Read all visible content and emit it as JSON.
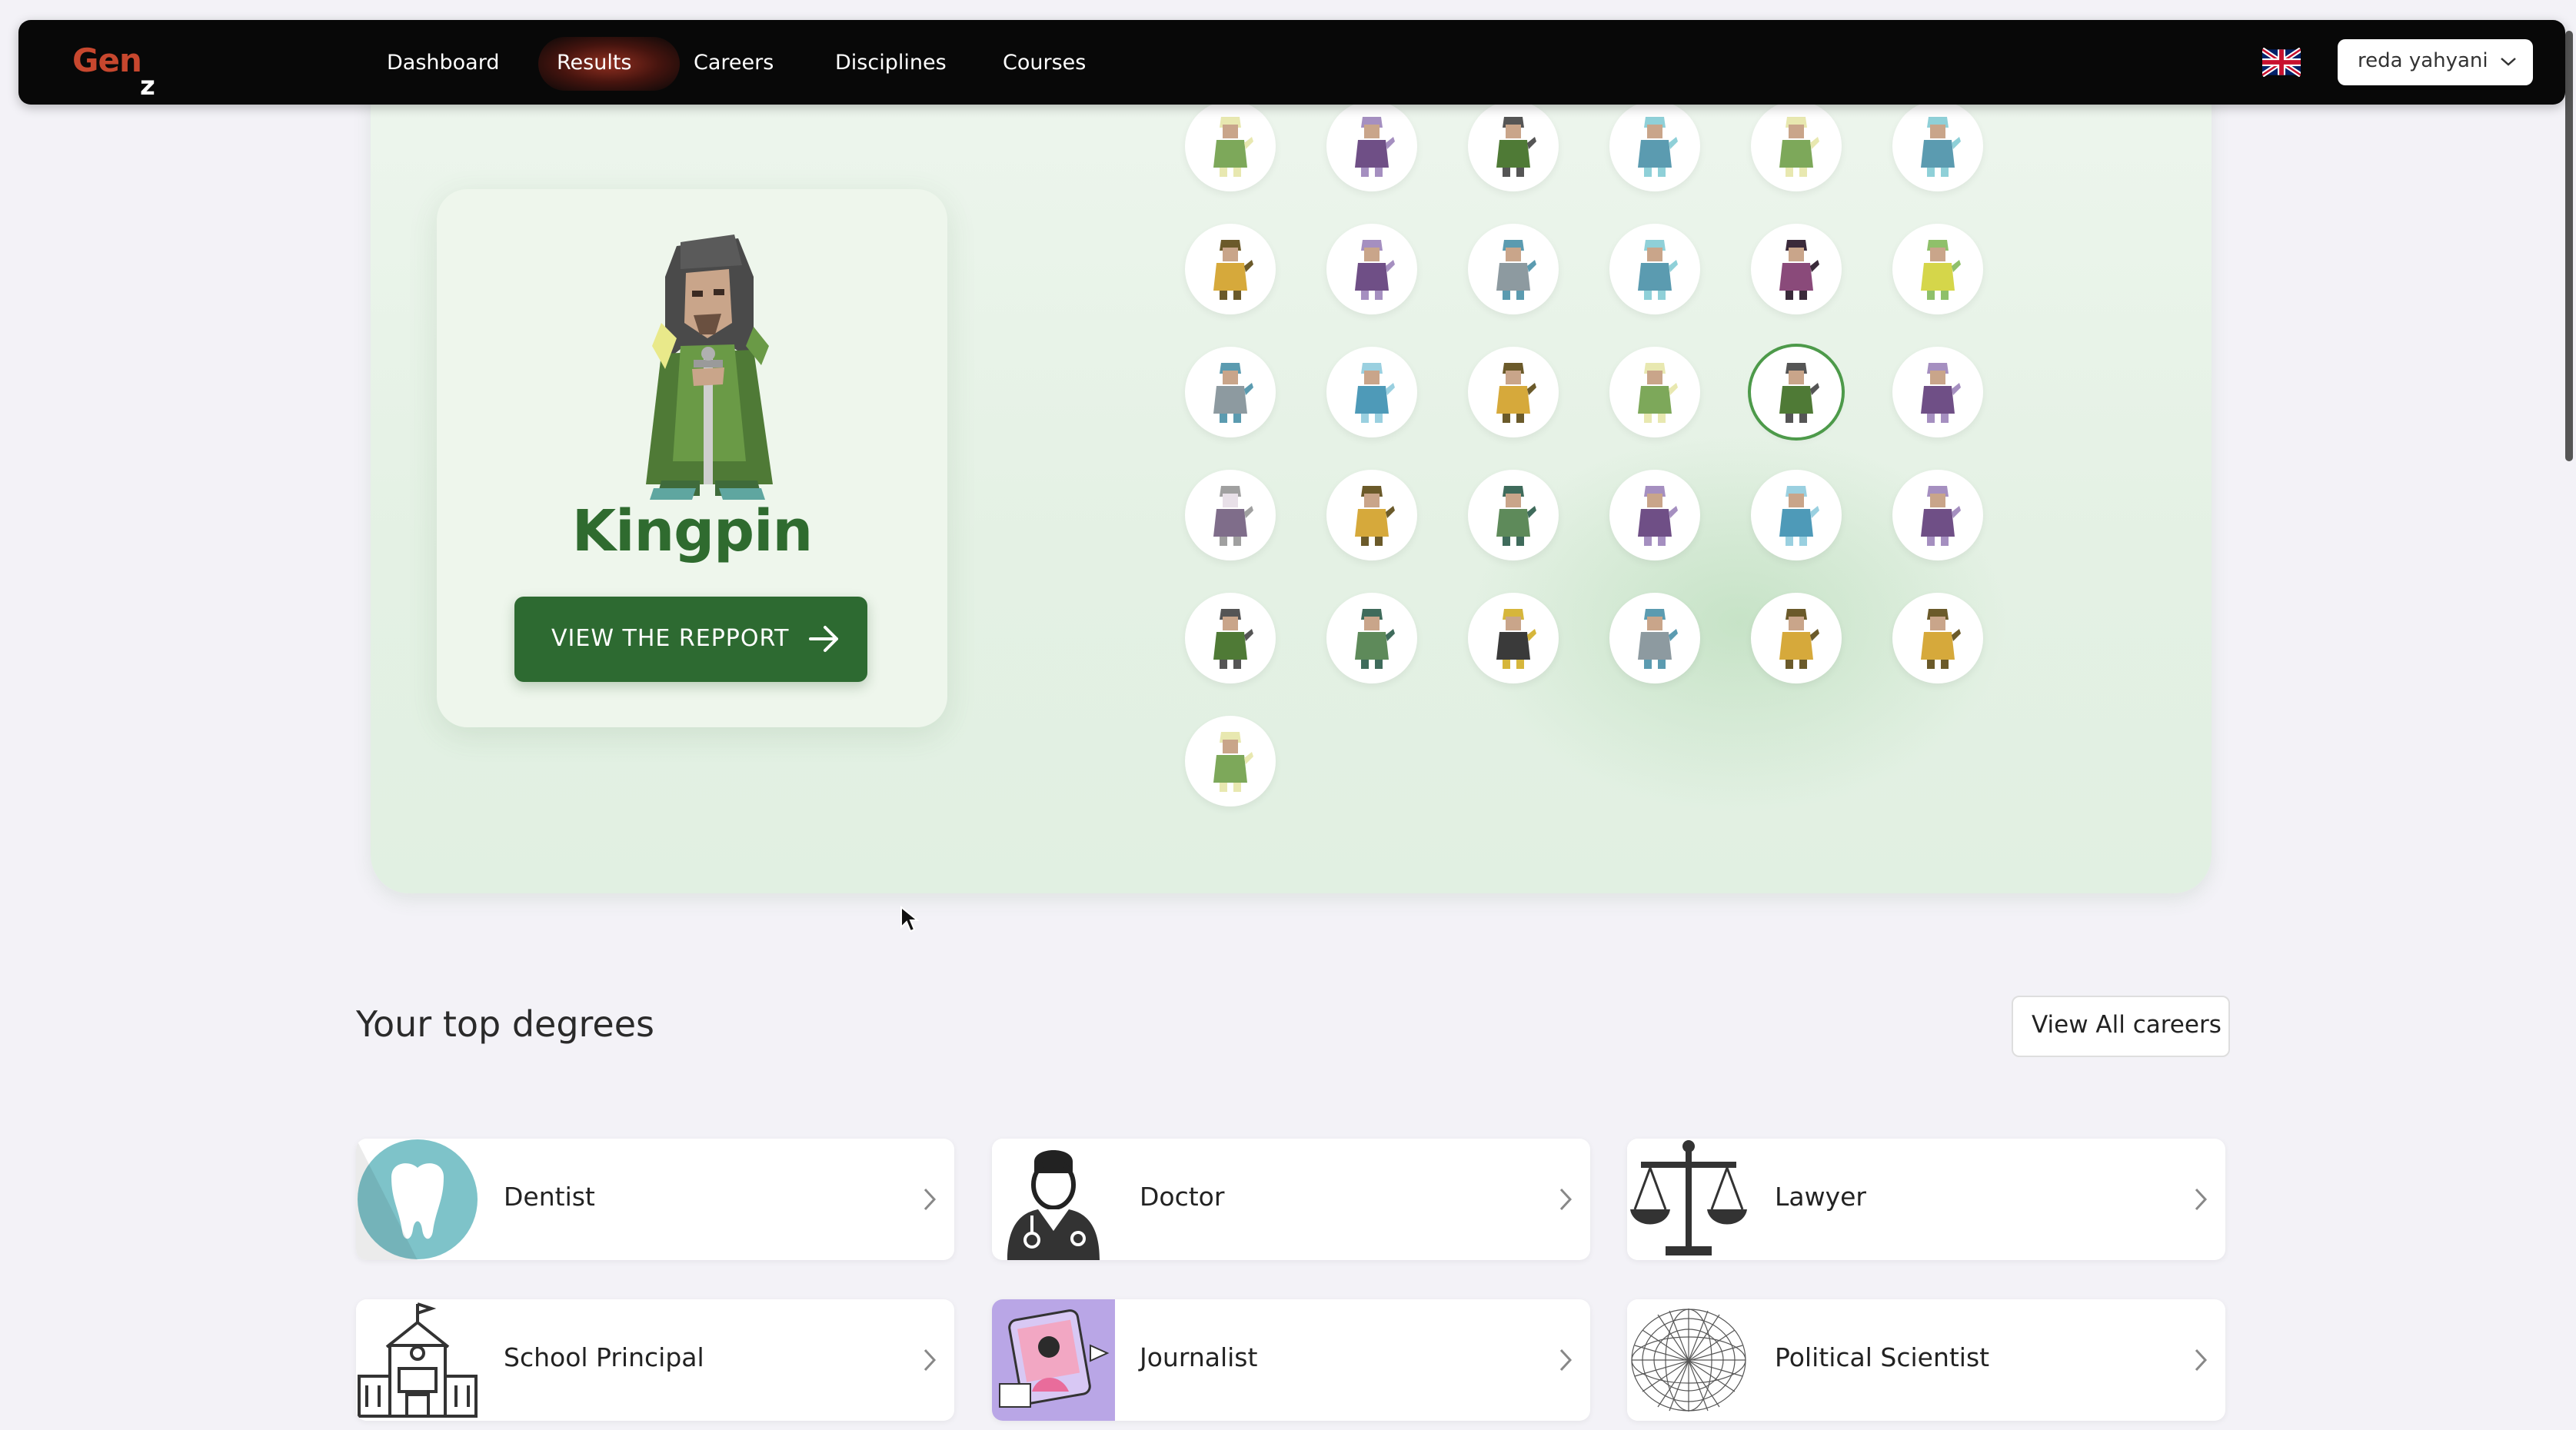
{
  "app": {
    "logo_main": "Gen",
    "logo_sub": "z"
  },
  "nav": {
    "items": [
      {
        "label": "Dashboard",
        "active": false
      },
      {
        "label": "Results",
        "active": true
      },
      {
        "label": "Careers",
        "active": false
      },
      {
        "label": "Disciplines",
        "active": false
      },
      {
        "label": "Courses",
        "active": false
      }
    ],
    "language_flag": "uk-flag-icon",
    "user": {
      "name": "reda yahyani"
    }
  },
  "result": {
    "personality": "Kingpin",
    "report_button": "VIEW THE REPPORT"
  },
  "avatars": [
    "elf-archer",
    "purple-sorcerer",
    "green-knight",
    "blue-engineer",
    "elf-archer",
    "blue-engineer",
    "yellow-warrior",
    "purple-sorcerer",
    "grey-scholar",
    "blue-engineer",
    "purple-dancer",
    "yellow-jester",
    "grey-scholar",
    "blue-inventor",
    "yellow-warrior",
    "elf-archer",
    "green-knight",
    "purple-sorcerer",
    "white-mage",
    "yellow-warrior",
    "green-ranger",
    "purple-sorcerer",
    "blue-inventor",
    "purple-sorcerer",
    "green-knight",
    "green-ranger",
    "dark-rogue",
    "grey-scholar",
    "yellow-warrior",
    "yellow-warrior",
    "elf-archer"
  ],
  "selected_avatar_index": 16,
  "degrees": {
    "title": "Your top degrees",
    "view_all": "View All careers",
    "items": [
      {
        "name": "Dentist",
        "icon": "tooth-icon"
      },
      {
        "name": "Doctor",
        "icon": "doctor-icon"
      },
      {
        "name": "Lawyer",
        "icon": "scales-icon"
      },
      {
        "name": "School Principal",
        "icon": "school-icon"
      },
      {
        "name": "Journalist",
        "icon": "journalist-icon"
      },
      {
        "name": "Political Scientist",
        "icon": "network-sphere-icon"
      }
    ]
  },
  "colors": {
    "nav_bg": "#080808",
    "logo": "#c7472e",
    "accent_green": "#2d6a31",
    "hero_bg": "#e4f1e4",
    "page_bg": "#f3f2f7"
  }
}
